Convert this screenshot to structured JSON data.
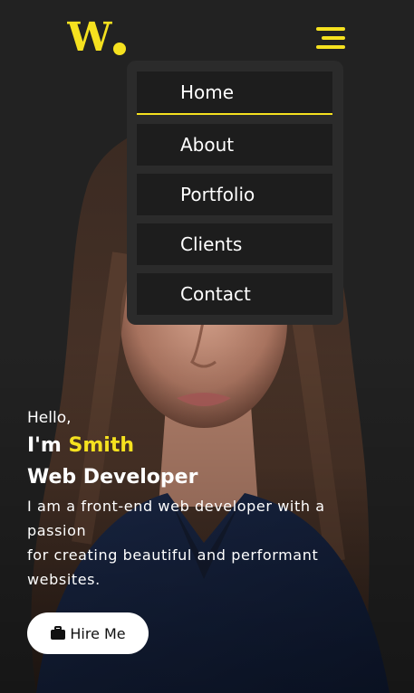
{
  "brand": {
    "logo_text": "W.",
    "accent": "#f5e11f",
    "background": "#222222"
  },
  "nav": {
    "toggle_icon": "hamburger-icon",
    "items": [
      {
        "label": "Home",
        "active": true
      },
      {
        "label": "About",
        "active": false
      },
      {
        "label": "Portfolio",
        "active": false
      },
      {
        "label": "Clients",
        "active": false
      },
      {
        "label": "Contact",
        "active": false
      }
    ]
  },
  "hero": {
    "greeting": "Hello,",
    "intro_prefix": "I'm ",
    "name": "Smith",
    "role": "Web Developer",
    "description_lines": [
      "I am a front-end web developer with a",
      "passion",
      "for creating beautiful and performant",
      "websites."
    ],
    "cta_label": "Hire Me",
    "cta_icon": "briefcase-icon"
  }
}
